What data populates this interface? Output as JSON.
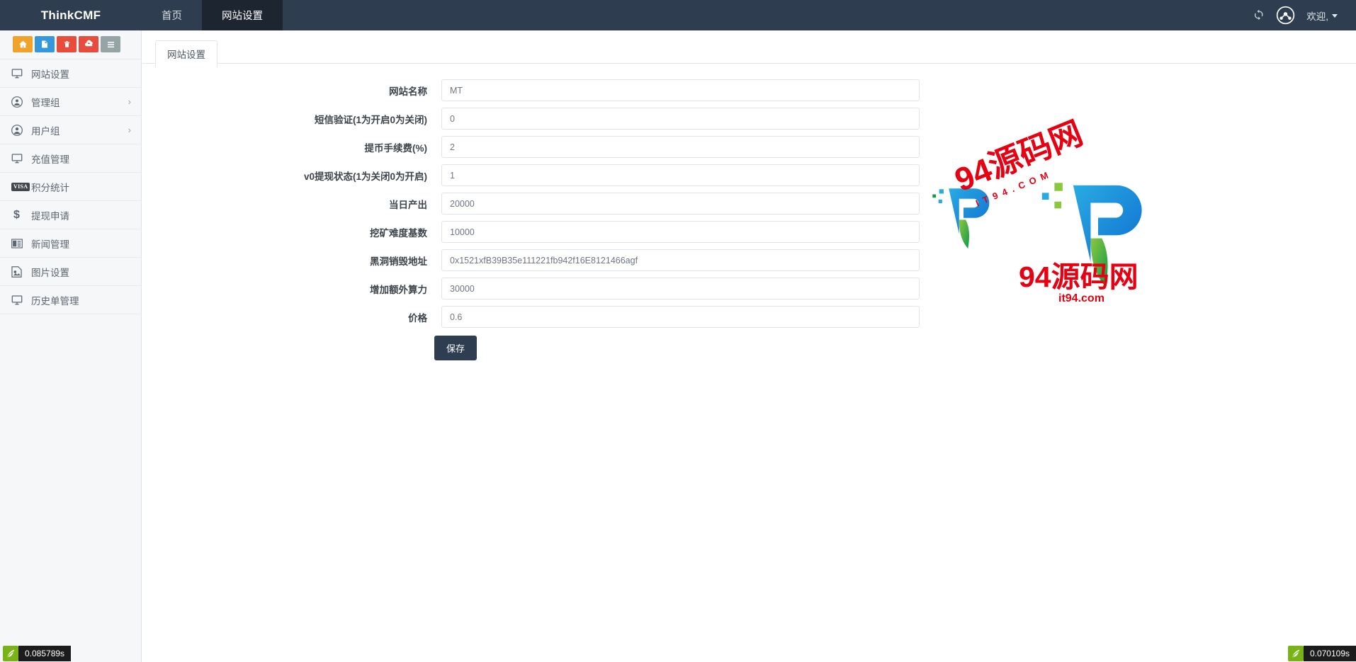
{
  "header": {
    "brand": "ThinkCMF",
    "nav": [
      {
        "label": "首页",
        "active": false
      },
      {
        "label": "网站设置",
        "active": true
      }
    ],
    "refresh_icon": "refresh-icon",
    "avatar_icon": "avatar-icon",
    "welcome_label": "欢迎,"
  },
  "sidebar": {
    "quick_buttons": [
      {
        "name": "home-quick-button",
        "icon": "home-icon",
        "color": "#f0a32a"
      },
      {
        "name": "file-quick-button",
        "icon": "file-icon",
        "color": "#3598dc"
      },
      {
        "name": "trash-quick-button",
        "icon": "trash-icon",
        "color": "#e74c3c"
      },
      {
        "name": "cache-quick-button",
        "icon": "cloud-icon",
        "color": "#e74c3c"
      },
      {
        "name": "list-quick-button",
        "icon": "list-icon",
        "color": "#95a5a6"
      }
    ],
    "items": [
      {
        "label": "网站设置",
        "icon": "monitor-icon",
        "arrow": false
      },
      {
        "label": "管理组",
        "icon": "user-badge-icon",
        "arrow": true
      },
      {
        "label": "用户组",
        "icon": "user-circle-icon",
        "arrow": true
      },
      {
        "label": "充值管理",
        "icon": "monitor-icon",
        "arrow": false
      },
      {
        "label": "积分统计",
        "icon": "visa-icon",
        "arrow": false
      },
      {
        "label": "提现申请",
        "icon": "dollar-icon",
        "arrow": false
      },
      {
        "label": "新闻管理",
        "icon": "news-icon",
        "arrow": false
      },
      {
        "label": "图片设置",
        "icon": "image-icon",
        "arrow": false
      },
      {
        "label": "历史单管理",
        "icon": "monitor-icon",
        "arrow": false
      }
    ],
    "arrow_glyph": "›"
  },
  "main": {
    "tab_label": "网站设置",
    "fields": [
      {
        "label": "网站名称",
        "value": "MT",
        "name": "site-name-input"
      },
      {
        "label": "短信验证(1为开启0为关闭)",
        "value": "0",
        "name": "sms-verify-input"
      },
      {
        "label": "提币手续费(%)",
        "value": "2",
        "name": "withdraw-fee-input"
      },
      {
        "label": "v0提现状态(1为关闭0为开启)",
        "value": "1",
        "name": "v0-withdraw-status-input"
      },
      {
        "label": "当日产出",
        "value": "20000",
        "name": "daily-output-input"
      },
      {
        "label": "挖矿难度基数",
        "value": "10000",
        "name": "mining-difficulty-input"
      },
      {
        "label": "黑洞销毁地址",
        "value": "0x1521xfB39B35e111221fb942f16E8121466agf",
        "name": "burn-address-input"
      },
      {
        "label": "增加额外算力",
        "value": "30000",
        "name": "extra-hashrate-input"
      },
      {
        "label": "价格",
        "value": "0.6",
        "name": "price-input"
      }
    ],
    "save_label": "保存"
  },
  "watermark": {
    "title": "94源码网",
    "domain": "it94.com",
    "subtitle_top": "94源码网",
    "subtitle_latin": "I T 9 4 . C O M"
  },
  "footer": {
    "left_time": "0.085789s",
    "right_time": "0.070109s",
    "leaf_icon": "thinkphp-leaf-icon"
  },
  "colors": {
    "header_bg": "#2e3e50",
    "active_tab_bg": "#1c2530",
    "sidebar_bg": "#f6f7f9",
    "accent_red": "#e60012",
    "button_bg": "#2e3e50"
  }
}
